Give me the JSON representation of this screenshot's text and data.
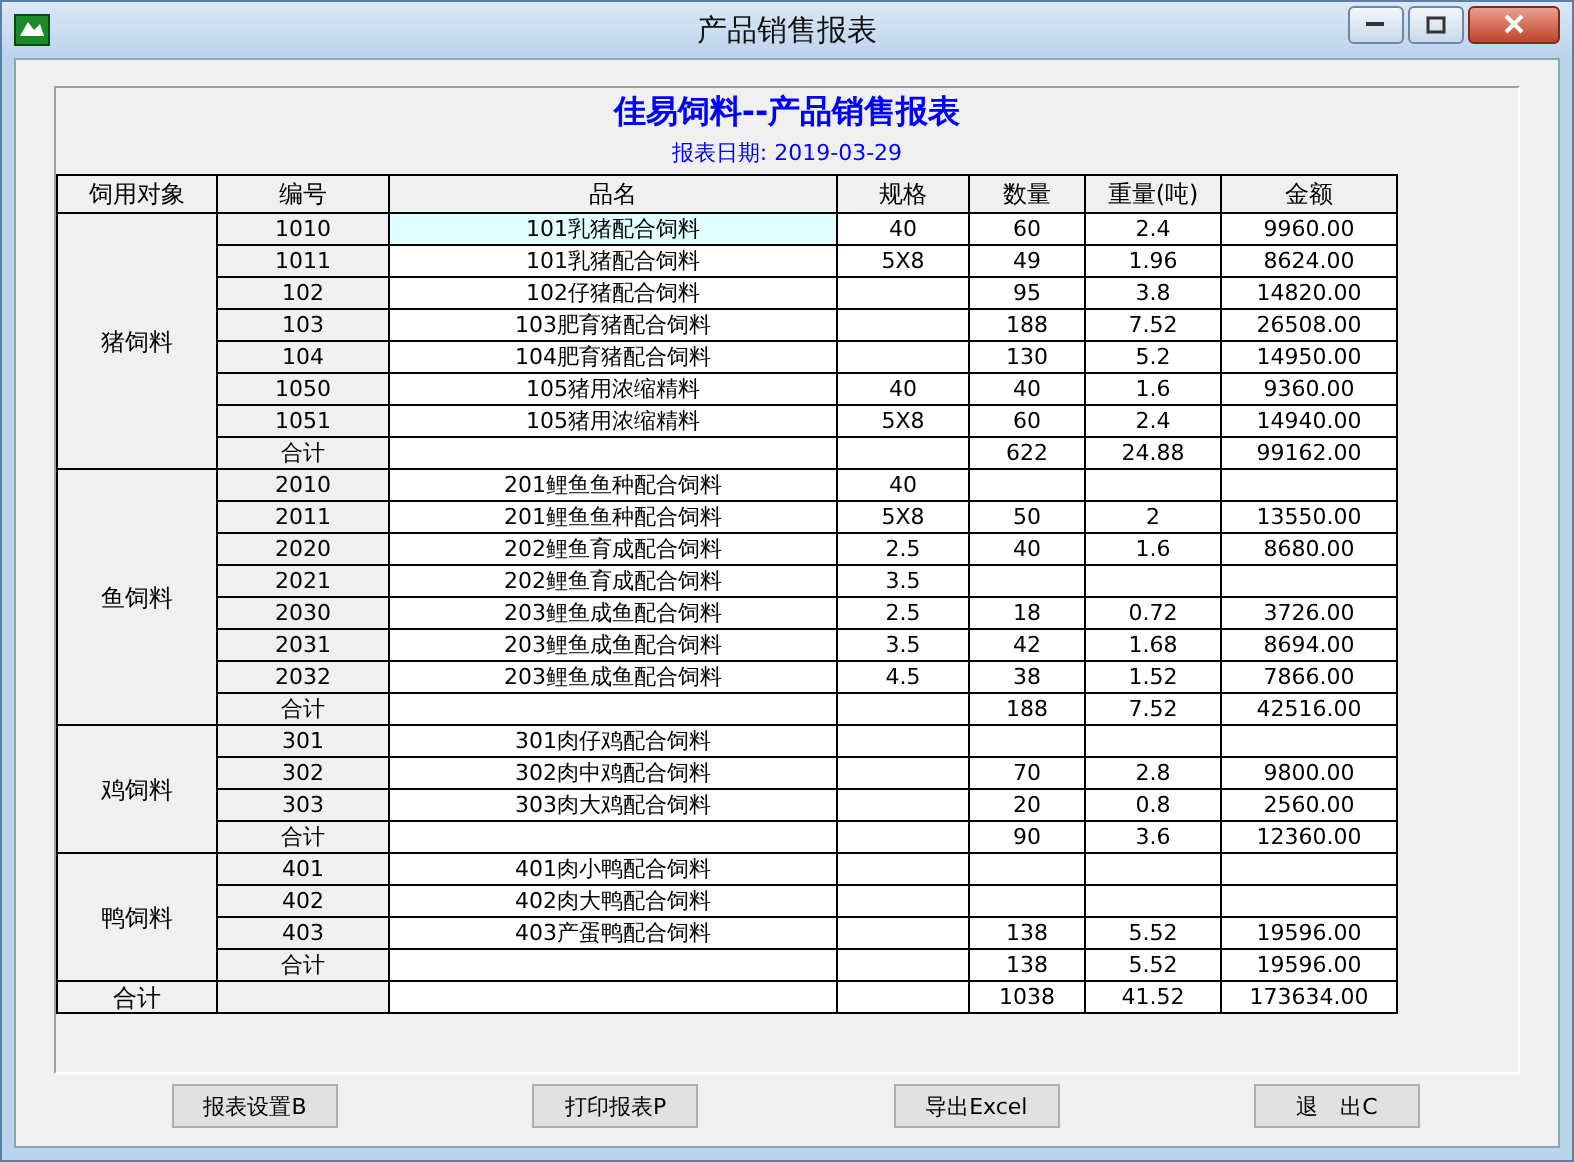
{
  "window": {
    "title": "产品销售报表"
  },
  "report": {
    "title": "佳易饲料--产品销售报表",
    "date": "报表日期: 2019-03-29"
  },
  "table": {
    "columns": [
      "饲用对象",
      "编号",
      "品名",
      "规格",
      "数量",
      "重量(吨)",
      "金额"
    ],
    "groups": [
      {
        "name": "猪饲料",
        "rows": [
          {
            "code": "1010",
            "name": "101乳猪配合饲料",
            "spec": "40",
            "qty": "60",
            "weight": "2.4",
            "amount": "9960.00",
            "selected": true
          },
          {
            "code": "1011",
            "name": "101乳猪配合饲料",
            "spec": "5X8",
            "qty": "49",
            "weight": "1.96",
            "amount": "8624.00",
            "selected": false
          },
          {
            "code": "102",
            "name": "102仔猪配合饲料",
            "qty": "95",
            "weight": "3.8",
            "amount": "14820.00",
            "selected": false
          },
          {
            "code": "103",
            "name": "103肥育猪配合饲料",
            "qty": "188",
            "weight": "7.52",
            "amount": "26508.00",
            "selected": false
          },
          {
            "code": "104",
            "name": "104肥育猪配合饲料",
            "qty": "130",
            "weight": "5.2",
            "amount": "14950.00",
            "selected": false
          },
          {
            "code": "1050",
            "name": "105猪用浓缩精料",
            "spec": "40",
            "qty": "40",
            "weight": "1.6",
            "amount": "9360.00",
            "selected": false
          },
          {
            "code": "1051",
            "name": "105猪用浓缩精料",
            "spec": "5X8",
            "qty": "60",
            "weight": "2.4",
            "amount": "14940.00",
            "selected": false
          }
        ],
        "subtotal": {
          "label": "合计",
          "qty": "622",
          "weight": "24.88",
          "amount": "99162.00"
        }
      },
      {
        "name": "鱼饲料",
        "rows": [
          {
            "code": "2010",
            "name": "201鲤鱼鱼种配合饲料",
            "spec": "40",
            "selected": false
          },
          {
            "code": "2011",
            "name": "201鲤鱼鱼种配合饲料",
            "spec": "5X8",
            "qty": "50",
            "weight": "2",
            "amount": "13550.00",
            "selected": false
          },
          {
            "code": "2020",
            "name": "202鲤鱼育成配合饲料",
            "spec": "2.5",
            "qty": "40",
            "weight": "1.6",
            "amount": "8680.00",
            "selected": false
          },
          {
            "code": "2021",
            "name": "202鲤鱼育成配合饲料",
            "spec": "3.5",
            "selected": false
          },
          {
            "code": "2030",
            "name": "203鲤鱼成鱼配合饲料",
            "spec": "2.5",
            "qty": "18",
            "weight": "0.72",
            "amount": "3726.00",
            "selected": false
          },
          {
            "code": "2031",
            "name": "203鲤鱼成鱼配合饲料",
            "spec": "3.5",
            "qty": "42",
            "weight": "1.68",
            "amount": "8694.00",
            "selected": false
          },
          {
            "code": "2032",
            "name": "203鲤鱼成鱼配合饲料",
            "spec": "4.5",
            "qty": "38",
            "weight": "1.52",
            "amount": "7866.00",
            "selected": false
          }
        ],
        "subtotal": {
          "label": "合计",
          "qty": "188",
          "weight": "7.52",
          "amount": "42516.00"
        }
      },
      {
        "name": "鸡饲料",
        "rows": [
          {
            "code": "301",
            "name": "301肉仔鸡配合饲料",
            "selected": false
          },
          {
            "code": "302",
            "name": "302肉中鸡配合饲料",
            "qty": "70",
            "weight": "2.8",
            "amount": "9800.00",
            "selected": false
          },
          {
            "code": "303",
            "name": "303肉大鸡配合饲料",
            "qty": "20",
            "weight": "0.8",
            "amount": "2560.00",
            "selected": false
          }
        ],
        "subtotal": {
          "label": "合计",
          "qty": "90",
          "weight": "3.6",
          "amount": "12360.00"
        }
      },
      {
        "name": "鸭饲料",
        "rows": [
          {
            "code": "401",
            "name": "401肉小鸭配合饲料",
            "selected": false
          },
          {
            "code": "402",
            "name": "402肉大鸭配合饲料",
            "selected": false
          },
          {
            "code": "403",
            "name": "403产蛋鸭配合饲料",
            "qty": "138",
            "weight": "5.52",
            "amount": "19596.00",
            "selected": false
          }
        ],
        "subtotal": {
          "label": "合计",
          "qty": "138",
          "weight": "5.52",
          "amount": "19596.00"
        }
      }
    ],
    "total": {
      "label": "合计",
      "qty": "1038",
      "weight": "41.52",
      "amount": "173634.00"
    }
  },
  "buttons": [
    "报表设置B",
    "打印报表P",
    "导出Excel",
    "退　出C"
  ]
}
